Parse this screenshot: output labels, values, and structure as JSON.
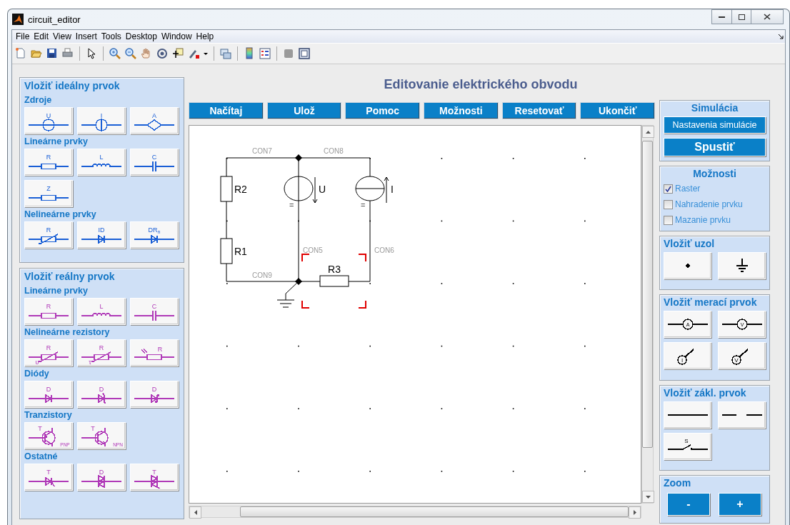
{
  "window": {
    "title": "circuit_editor"
  },
  "menu": [
    "File",
    "Edit",
    "View",
    "Insert",
    "Tools",
    "Desktop",
    "Window",
    "Help"
  ],
  "palettes": [
    {
      "title": "Vložiť ideálny prvok",
      "color": "#1a5fd6",
      "groups": [
        {
          "title": "Zdroje",
          "items": [
            {
              "kind": "voltage_source",
              "label": "U"
            },
            {
              "kind": "current_source",
              "label": "I"
            },
            {
              "kind": "dependent_source",
              "label": "A"
            }
          ]
        },
        {
          "title": "Lineárne prvky",
          "items": [
            {
              "kind": "resistor",
              "label": "R"
            },
            {
              "kind": "inductor",
              "label": "L"
            },
            {
              "kind": "capacitor",
              "label": "C"
            },
            {
              "kind": "resistor",
              "label": "Z"
            }
          ]
        },
        {
          "title": "Nelineárne prvky",
          "items": [
            {
              "kind": "varistor",
              "label": "R"
            },
            {
              "kind": "diode",
              "label": "ID"
            },
            {
              "kind": "diode",
              "label": "DR",
              "sub": "n"
            }
          ]
        }
      ]
    },
    {
      "title": "Vložiť reálny prvok",
      "color": "#b03ab8",
      "groups": [
        {
          "title": "Lineárne prvky",
          "items": [
            {
              "kind": "resistor",
              "label": "R"
            },
            {
              "kind": "inductor",
              "label": "L"
            },
            {
              "kind": "capacitor",
              "label": "C"
            }
          ]
        },
        {
          "title": "Nelineárne rezistory",
          "items": [
            {
              "kind": "varistor",
              "label": "R",
              "tag": "υ"
            },
            {
              "kind": "varistor",
              "label": "R",
              "tag": "τ"
            },
            {
              "kind": "photoresistor",
              "label": "R"
            }
          ]
        },
        {
          "title": "Diódy",
          "items": [
            {
              "kind": "diode",
              "label": "D"
            },
            {
              "kind": "zener",
              "label": "D"
            },
            {
              "kind": "schottky",
              "label": "D"
            }
          ]
        },
        {
          "title": "Tranzistory",
          "items": [
            {
              "kind": "pnp",
              "label": "T",
              "tag": "PNP"
            },
            {
              "kind": "npn",
              "label": "T",
              "tag": "NPN"
            }
          ]
        },
        {
          "title": "Ostatné",
          "items": [
            {
              "kind": "thyristor",
              "label": "T"
            },
            {
              "kind": "diac",
              "label": "D"
            },
            {
              "kind": "triac",
              "label": "T"
            }
          ]
        }
      ]
    }
  ],
  "heading": "Editovanie elektrického obvodu",
  "actions": [
    "Načítaj",
    "Ulož",
    "Pomoc",
    "Možnosti",
    "Resetovať",
    "Ukončiť"
  ],
  "circuit": {
    "wire_labels": [
      "CON7",
      "CON8",
      "CON5",
      "CON6",
      "CON9"
    ],
    "components": [
      {
        "kind": "resistor",
        "label": "R2",
        "selected": false
      },
      {
        "kind": "resistor",
        "label": "R1",
        "selected": false
      },
      {
        "kind": "voltage_source",
        "label": "U",
        "mark": "=",
        "selected": false
      },
      {
        "kind": "current_source",
        "label": "I",
        "mark": "=",
        "selected": false
      },
      {
        "kind": "resistor",
        "label": "R3",
        "selected": true
      }
    ]
  },
  "simulation": {
    "title": "Simulácia",
    "buttons": [
      {
        "kind": "normal",
        "label": "Nastavenia simulácie"
      },
      {
        "kind": "primary",
        "label": "Spustiť"
      }
    ]
  },
  "options": {
    "title": "Možnosti",
    "items": [
      {
        "label": "Raster",
        "checked": true
      },
      {
        "label": "Nahradenie prvku",
        "checked": false
      },
      {
        "label": "Mazanie prvku",
        "checked": false
      }
    ]
  },
  "tool_panels": [
    {
      "title": "Vložiť uzol",
      "items": [
        {
          "kind": "node"
        },
        {
          "kind": "ground"
        }
      ]
    },
    {
      "title": "Vložiť merací prvok",
      "items": [
        {
          "kind": "ammeter",
          "label": "A"
        },
        {
          "kind": "voltmeter",
          "label": "V"
        },
        {
          "kind": "current_probe",
          "label": "I"
        },
        {
          "kind": "voltage_probe",
          "label": "V"
        }
      ]
    },
    {
      "title": "Vložiť zákl. prvok",
      "items": [
        {
          "kind": "wire"
        },
        {
          "kind": "dashed_wire"
        },
        {
          "kind": "switch",
          "label": "S"
        }
      ]
    }
  ],
  "zoom": {
    "title": "Zoom",
    "buttons": [
      "-",
      "+"
    ]
  }
}
